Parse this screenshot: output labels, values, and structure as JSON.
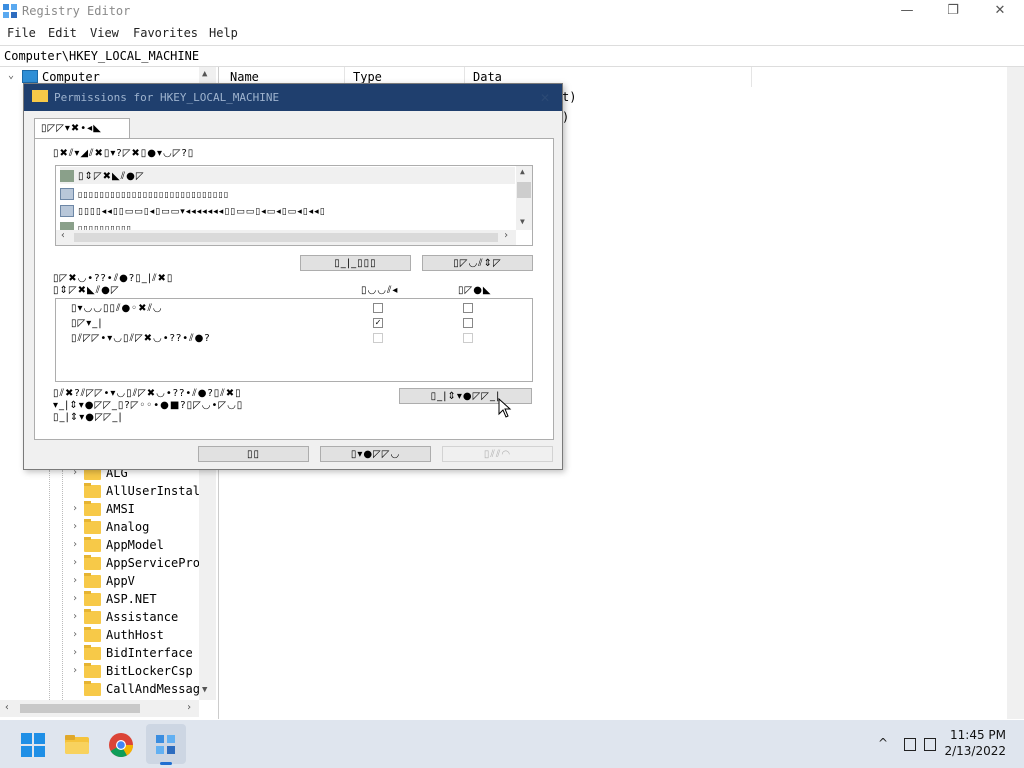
{
  "window": {
    "title": "Registry Editor",
    "controls": {
      "minimize": "—",
      "maximize": "❐",
      "close": "✕"
    }
  },
  "menu": [
    "File",
    "Edit",
    "View",
    "Favorites",
    "Help"
  ],
  "address": "Computer\\HKEY_LOCAL_MACHINE",
  "tree": {
    "root": "Computer",
    "items": [
      "ALG",
      "AllUserInstal",
      "AMSI",
      "Analog",
      "AppModel",
      "AppServicePro",
      "AppV",
      "ASP.NET",
      "Assistance",
      "AuthHost",
      "BidInterface",
      "BitLockerCsp",
      "CallAndMessag"
    ]
  },
  "list": {
    "columns": [
      "Name",
      "Type",
      "Data"
    ],
    "partial_values": [
      "t)",
      ")"
    ]
  },
  "dialog": {
    "title": "Permissions for HKEY_LOCAL_MACHINE",
    "close": "✕",
    "tab_label": "▯◸◸▾✖•◂◣",
    "group_label": "▯✖⫽▾◢⫽✖▯▾?◸✖▯●▾◡◸?▯",
    "users": [
      "▯⇕◸✖◣⫽●◸",
      "▯▯▯▯▯▯▯▯▯▯▯▯▯▯▯▯▯▯▯▯▯▯▯▯▯▯▯▯",
      "▯▯▯▯◂◂▯▯▭▭▯◂▯▭▭▾◂◂◂◂◂◂◂▯▯▭▭▯◂▭◂▯▭◂▯◂◂▯",
      "▯▯▯▯▯▯▯▯▯▯"
    ],
    "add_button": "▯_|_▯▯▯",
    "remove_button": "▯◸◡⫽⇕◸",
    "perm_label_1": "▯◸✖◡•??•⫽●?▯_|⫽✖▯",
    "perm_label_2": "▯⇕◸✖◣⫽●◸",
    "allow_header": "▯◡◡⫽◂",
    "deny_header": "▯◸●◣",
    "permissions": [
      {
        "label": "▯▾◡◡▯▯⫽●◦✖⫽◡",
        "allow": "",
        "deny": ""
      },
      {
        "label": "▯◸▾_|",
        "allow": "✓",
        "deny": ""
      },
      {
        "label": "▯⫽◸◸•▾◡▯⫽◸✖◡•??•⫽●?",
        "allow": "",
        "deny": ""
      }
    ],
    "advanced_text_1": "▯⫽✖?⫽◸◸•▾◡▯⫽◸✖◡•??•⫽●?▯⫽✖▯",
    "advanced_text_2": "▾_|⇕▾●◸◸_▯?◸◦◦•●■?▯◸◡•◸◡▯",
    "advanced_text_3": "▯_|⇕▾●◸◸_|",
    "advanced_button": "▯_|⇕▾●◸◸_|",
    "ok_button": "▯▯",
    "cancel_button": "▯▾●◸◸◡",
    "apply_button": "▯⫽⫽◠"
  },
  "clock": {
    "time": "11:45 PM",
    "date": "2/13/2022"
  }
}
